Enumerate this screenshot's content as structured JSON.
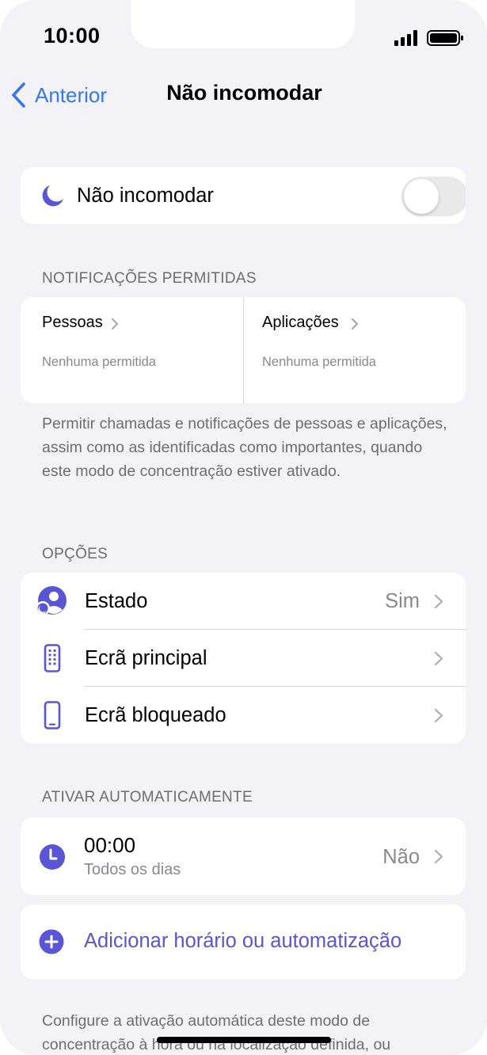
{
  "status_bar": {
    "time": "10:00"
  },
  "nav": {
    "back_label": "Anterior",
    "title": "Não incomodar"
  },
  "focus_toggle": {
    "label": "Não incomodar",
    "enabled": false
  },
  "notifications": {
    "header": "NOTIFICAÇÕES PERMITIDAS",
    "people": {
      "label": "Pessoas",
      "subtitle": "Nenhuma permitida"
    },
    "apps": {
      "label": "Aplicações",
      "subtitle": "Nenhuma permitida"
    },
    "footnote": "Permitir chamadas e notificações de pessoas e aplicações, assim como as identificadas como importantes, quando este modo de concentração estiver ativado."
  },
  "options": {
    "header": "OPÇÕES",
    "items": [
      {
        "label": "Estado",
        "value": "Sim",
        "icon": "focus-status-icon"
      },
      {
        "label": "Ecrã principal",
        "value": "",
        "icon": "home-screen-icon"
      },
      {
        "label": "Ecrã bloqueado",
        "value": "",
        "icon": "lock-screen-icon"
      }
    ]
  },
  "automation": {
    "header": "ATIVAR AUTOMATICAMENTE",
    "schedule": {
      "time": "00:00",
      "days": "Todos os dias",
      "value": "Não",
      "icon": "clock-icon"
    },
    "add_label": "Adicionar horário ou automatização",
    "footnote": "Configure a ativação automática deste modo de concentração à hora ou na localização definida, ou"
  },
  "colors": {
    "accent_purple": "#5856d6",
    "link_blue": "#3478f6",
    "background": "#f2f2f7"
  }
}
